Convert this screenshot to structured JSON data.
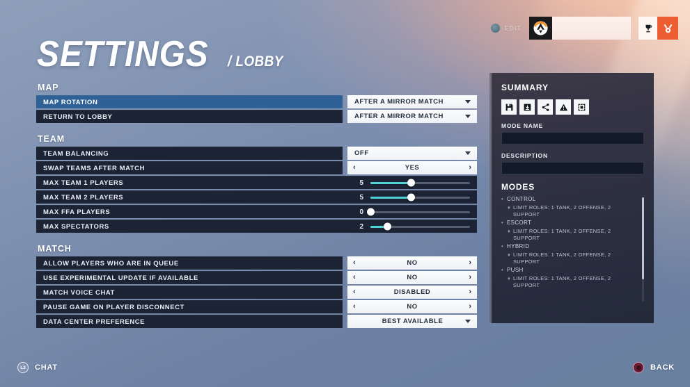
{
  "header": {
    "edit_label": "EDIT",
    "edit_dot_icon": "circle-dot-icon",
    "logo_icon": "overwatch-logo-icon",
    "player_bar_value": "",
    "buttons": [
      {
        "icon": "trophy-icon",
        "style": "white"
      },
      {
        "icon": "medal-icon",
        "style": "orange"
      }
    ]
  },
  "title": {
    "main": "SETTINGS",
    "sub": "/ LOBBY"
  },
  "sections": [
    {
      "name": "MAP",
      "rows": [
        {
          "label": "MAP ROTATION",
          "type": "dropdown",
          "value": "AFTER A MIRROR MATCH",
          "selected": true
        },
        {
          "label": "RETURN TO LOBBY",
          "type": "dropdown",
          "value": "AFTER A MIRROR MATCH",
          "selected": false
        }
      ]
    },
    {
      "name": "TEAM",
      "rows": [
        {
          "label": "TEAM BALANCING",
          "type": "dropdown",
          "value": "OFF",
          "selected": false
        },
        {
          "label": "SWAP TEAMS AFTER MATCH",
          "type": "arrows",
          "value": "YES",
          "selected": false
        },
        {
          "label": "MAX TEAM 1 PLAYERS",
          "type": "slider",
          "value": "5",
          "percent": 41,
          "selected": false
        },
        {
          "label": "MAX TEAM 2 PLAYERS",
          "type": "slider",
          "value": "5",
          "percent": 41,
          "selected": false
        },
        {
          "label": "MAX FFA PLAYERS",
          "type": "slider",
          "value": "0",
          "percent": 0,
          "selected": false
        },
        {
          "label": "MAX SPECTATORS",
          "type": "slider",
          "value": "2",
          "percent": 17,
          "selected": false
        }
      ]
    },
    {
      "name": "MATCH",
      "rows": [
        {
          "label": "ALLOW PLAYERS WHO ARE IN QUEUE",
          "type": "arrows",
          "value": "NO",
          "selected": false
        },
        {
          "label": "USE EXPERIMENTAL UPDATE IF AVAILABLE",
          "type": "arrows",
          "value": "NO",
          "selected": false
        },
        {
          "label": "MATCH VOICE CHAT",
          "type": "arrows",
          "value": "DISABLED",
          "selected": false
        },
        {
          "label": "PAUSE GAME ON PLAYER DISCONNECT",
          "type": "arrows",
          "value": "NO",
          "selected": false
        },
        {
          "label": "DATA CENTER PREFERENCE",
          "type": "dropdown-centered",
          "value": "BEST AVAILABLE",
          "selected": false
        }
      ]
    }
  ],
  "summary": {
    "title": "SUMMARY",
    "icons": [
      "save-icon",
      "import-icon",
      "share-icon",
      "warning-icon",
      "copy-code-icon"
    ],
    "mode_name_label": "MODE NAME",
    "mode_name_value": "",
    "description_label": "DESCRIPTION",
    "description_value": "",
    "modes_title": "MODES",
    "modes": [
      {
        "name": "CONTROL",
        "detail": "LIMIT ROLES: 1 TANK, 2 OFFENSE, 2 SUPPORT"
      },
      {
        "name": "ESCORT",
        "detail": "LIMIT ROLES: 1 TANK, 2 OFFENSE, 2 SUPPORT"
      },
      {
        "name": "HYBRID",
        "detail": "LIMIT ROLES: 1 TANK, 2 OFFENSE, 2 SUPPORT"
      },
      {
        "name": "PUSH",
        "detail": "LIMIT ROLES: 1 TANK, 2 OFFENSE, 2 SUPPORT"
      }
    ]
  },
  "footer": {
    "chat_glyph": "L3",
    "chat_label": "CHAT",
    "back_glyph": "circle-button-icon",
    "back_label": "BACK"
  },
  "colors": {
    "accent_orange": "#ee5c32",
    "slider_cyan": "#4fd4d6",
    "row_selected_blue": "#2f6096",
    "row_dark": "#1b2334"
  }
}
